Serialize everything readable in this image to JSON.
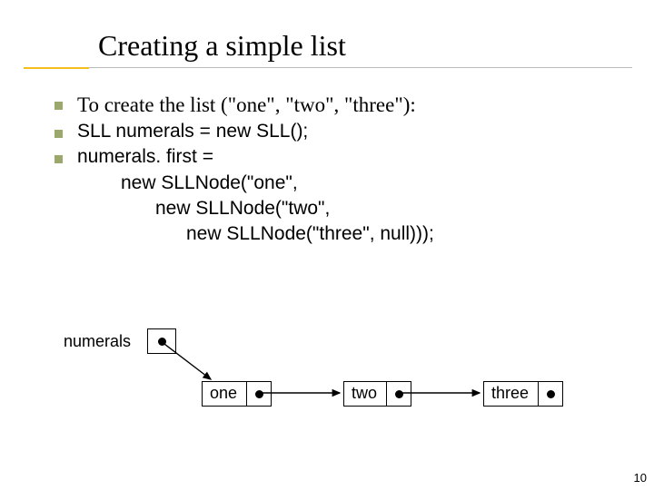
{
  "title": "Creating a simple list",
  "bullets": {
    "b1": "To create the list (\"one\", \"two\", \"three\"):",
    "b2": "SLL numerals = new SLL();",
    "b3": "numerals. first =",
    "b3_l2": "new SLLNode(\"one\",",
    "b3_l3": "new SLLNode(\"two\",",
    "b3_l4": "new SLLNode(\"three\", null)));"
  },
  "diagram": {
    "label": "numerals",
    "node1": "one",
    "node2": "two",
    "node3": "three"
  },
  "page_number": "10"
}
